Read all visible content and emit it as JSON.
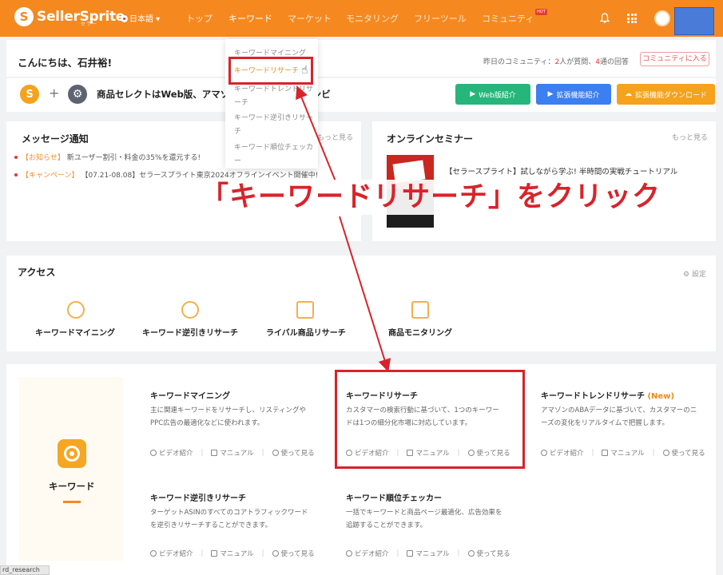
{
  "header": {
    "logo_text": "SellerSprite",
    "logo_sub": "セラー",
    "language": "日本語",
    "nav": [
      {
        "label": "トップ"
      },
      {
        "label": "キーワード"
      },
      {
        "label": "マーケット"
      },
      {
        "label": "モニタリング"
      },
      {
        "label": "フリーツール"
      },
      {
        "label": "コミュニティ"
      }
    ],
    "hot_badge": "HOT"
  },
  "dropdown": {
    "items": [
      "キーワードマイニング",
      "キーワードリサーチ",
      "キーワードトレンドリサーチ",
      "キーワード逆引きリサーチ",
      "キーワード順位チェッカー"
    ]
  },
  "welcome": {
    "greeting": "こんにちは、石井裕!",
    "stats_prefix": "昨日のコミュニティ：",
    "stats_q": "2",
    "stats_mid": "人が質問、",
    "stats_a": "4",
    "stats_suffix": "通の回答",
    "community_button": "コミュニティに入る"
  },
  "promo": {
    "text": "商品セレクトはWeb版、アマゾン拡張機能は最強コンビ",
    "buttons": [
      "Web版紹介",
      "拡張機能紹介",
      "拡張機能ダウンロード"
    ]
  },
  "messages": {
    "title": "メッセージ通知",
    "more": "もっと見る",
    "items": [
      {
        "tag": "【お知らせ】",
        "text": "新ユーザー割引・料金の35%を還元する!"
      },
      {
        "tag": "【キャンペーン】",
        "text": "【07.21-08.08】セラースプライト東京2024オフラインイベント開催中!"
      }
    ]
  },
  "seminar": {
    "title": "オンラインセミナー",
    "more": "もっと見る",
    "item": "【セラースプライト】試しながら学ぶ! 半時間の実戦チュートリアル"
  },
  "annotation": "「キーワードリサーチ」をクリック",
  "access": {
    "title": "アクセス",
    "settings": "設定",
    "items": [
      "キーワードマイニング",
      "キーワード逆引きリサーチ",
      "ライバル商品リサーチ",
      "商品モニタリング"
    ]
  },
  "keyword_section": {
    "label": "キーワード",
    "link_video": "ビデオ紹介",
    "link_manual": "マニュアル",
    "link_try": "使って見る",
    "new_badge": "(New)",
    "tools": [
      {
        "title": "キーワードマイニング",
        "desc": "主に関連キーワードをリサーチし、リスティングやPPC広告の最適化などに使われます。"
      },
      {
        "title": "キーワードリサーチ",
        "desc": "カスタマーの検索行動に基づいて、1つのキーワードは1つの細分化市場に対応しています。"
      },
      {
        "title": "キーワードトレンドリサーチ",
        "desc": "アマゾンのABAデータに基づいて、カスタマーのニーズの変化をリアルタイムで把握します。"
      },
      {
        "title": "キーワード逆引きリサーチ",
        "desc": "ターゲットASINのすべてのコアトラフィックワードを逆引きリサーチすることができます。"
      },
      {
        "title": "キーワード順位チェッカー",
        "desc": "一括でキーワードと商品ページ最適化、広告効果を追跡することができます。"
      }
    ]
  },
  "status_tip": "rd_research"
}
